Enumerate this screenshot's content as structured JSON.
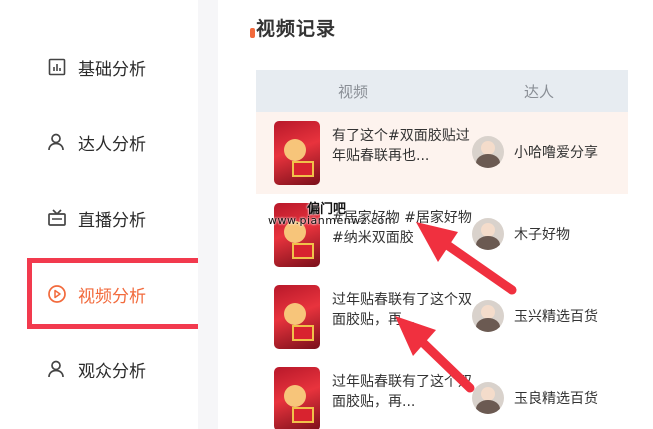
{
  "sidebar": {
    "items": [
      {
        "label": "基础分析",
        "icon": "bar-chart-icon"
      },
      {
        "label": "达人分析",
        "icon": "user-icon"
      },
      {
        "label": "直播分析",
        "icon": "tv-icon"
      },
      {
        "label": "视频分析",
        "icon": "play-circle-icon",
        "active": true
      },
      {
        "label": "观众分析",
        "icon": "user-icon"
      }
    ]
  },
  "main": {
    "section_title": "视频记录",
    "columns": {
      "video": "视频",
      "influencer": "达人"
    },
    "rows": [
      {
        "title": "有了这个#双面胶贴过年贴春联再也...",
        "influencer": "小哈噜爱分享"
      },
      {
        "title": "#居家好物 #居家好物 #纳米双面胶",
        "influencer": "木子好物"
      },
      {
        "title": "过年贴春联有了这个双面胶贴，再...",
        "influencer": "玉兴精选百货"
      },
      {
        "title": "过年贴春联有了这个双面胶贴，再...",
        "influencer": "玉良精选百货"
      }
    ]
  },
  "watermark": {
    "name": "偏门吧",
    "url": "www.pianmenwz.com"
  },
  "colors": {
    "accent": "#f26a3c",
    "highlight_box": "#f23a4e",
    "arrow": "#f0303f",
    "header_bg": "#e7ecf1",
    "row_highlight": "#fdf3ee"
  }
}
